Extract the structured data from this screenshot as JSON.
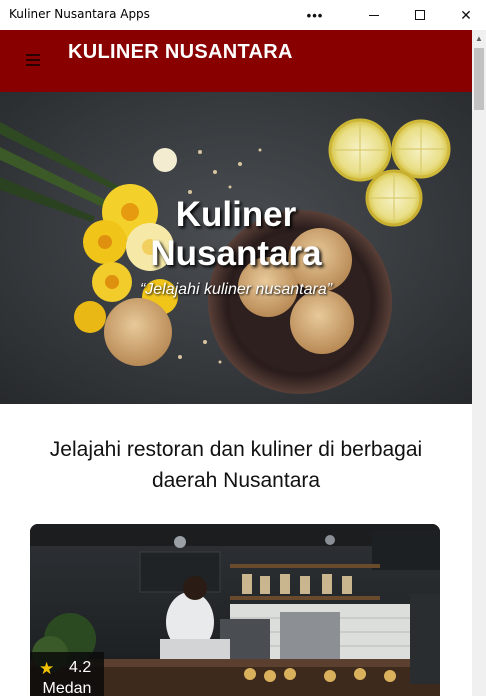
{
  "window": {
    "title": "Kuliner Nusantara Apps",
    "more_glyph": "•••",
    "close_glyph": "✕"
  },
  "navbar": {
    "brand": "KULINER NUSANTARA",
    "menu_icon": "hamburger-menu-icon",
    "background": "#880000"
  },
  "hero": {
    "title_line1": "Kuliner",
    "title_line2": "Nusantara",
    "tagline": "“Jelajahi kuliner nusantara”"
  },
  "intro": {
    "text": "Jelajahi restoran dan kuliner di berbagai daerah Nusantara"
  },
  "restaurant_card": {
    "rating": "4.2",
    "rating_star": "★",
    "city": "Medan",
    "star_color": "#f2c200"
  }
}
